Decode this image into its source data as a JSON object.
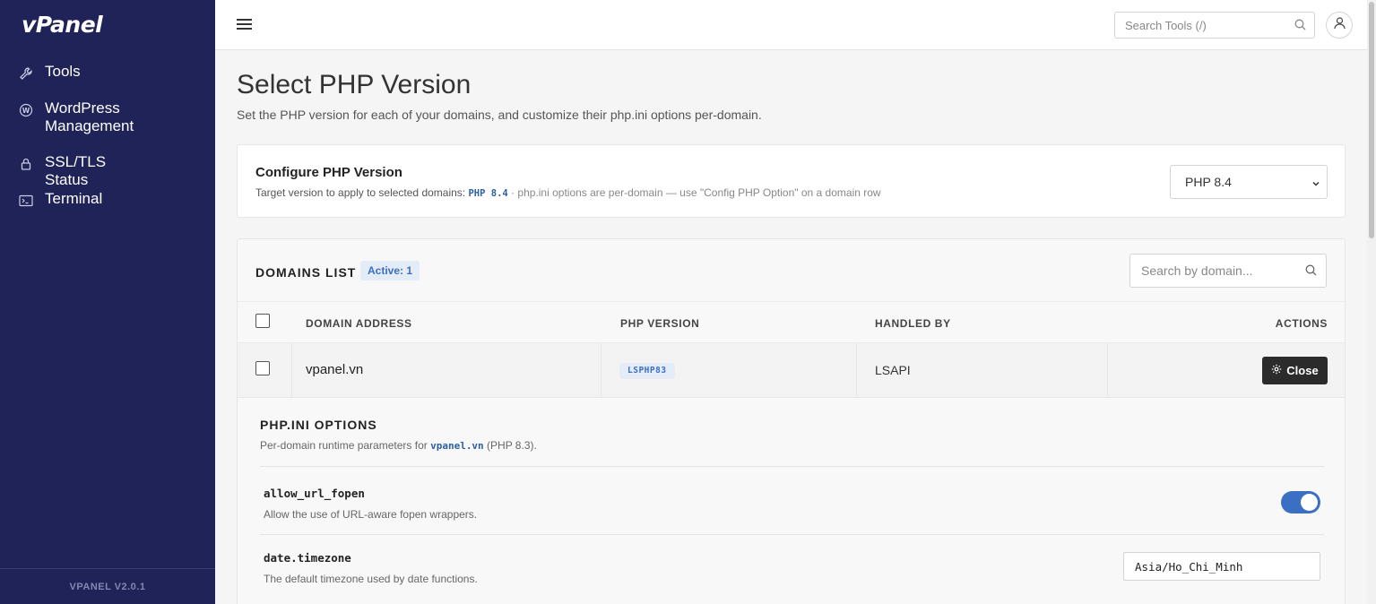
{
  "sidebar": {
    "logo": "vPanel",
    "items": [
      {
        "label": "Tools",
        "icon": "wrench-icon"
      },
      {
        "label": "WordPress Management",
        "icon": "wordpress-icon"
      },
      {
        "label": "SSL/TLS Status",
        "icon": "lock-icon"
      },
      {
        "label": "Terminal",
        "icon": "terminal-icon"
      }
    ],
    "version": "VPANEL V2.0.1"
  },
  "topbar": {
    "search_placeholder": "Search Tools (/)"
  },
  "page": {
    "title": "Select PHP Version",
    "subtitle": "Set the PHP version for each of your domains, and customize their php.ini options per-domain."
  },
  "configure": {
    "title": "Configure PHP Version",
    "desc_prefix": "Target version to apply to selected domains: ",
    "target_version": "PHP 8.4",
    "desc_suffix": " · php.ini options are per-domain — use \"Config PHP Option\" on a domain row",
    "selected_version": "PHP 8.4"
  },
  "domains": {
    "title": "DOMAINS LIST",
    "active_badge": "Active: 1",
    "search_placeholder": "Search by domain...",
    "columns": [
      "DOMAIN ADDRESS",
      "PHP VERSION",
      "HANDLED BY",
      "ACTIONS"
    ],
    "rows": [
      {
        "domain": "vpanel.vn",
        "php_version": "LSPHP83",
        "handler": "LSAPI",
        "action": "Close"
      }
    ]
  },
  "php_ini": {
    "title": "PHP.INI OPTIONS",
    "desc_prefix": "Per-domain runtime parameters for ",
    "domain": "vpanel.vn",
    "desc_suffix": " (PHP 8.3).",
    "options": [
      {
        "name": "allow_url_fopen",
        "description": "Allow the use of URL-aware fopen wrappers.",
        "enabled": true
      },
      {
        "name": "date.timezone",
        "description": "The default timezone used by date functions.",
        "value": "Asia/Ho_Chi_Minh"
      }
    ]
  },
  "colors": {
    "sidebar_bg": "#1f2358",
    "accent": "#3a6fc4",
    "close_button": "#2b2b2b"
  }
}
